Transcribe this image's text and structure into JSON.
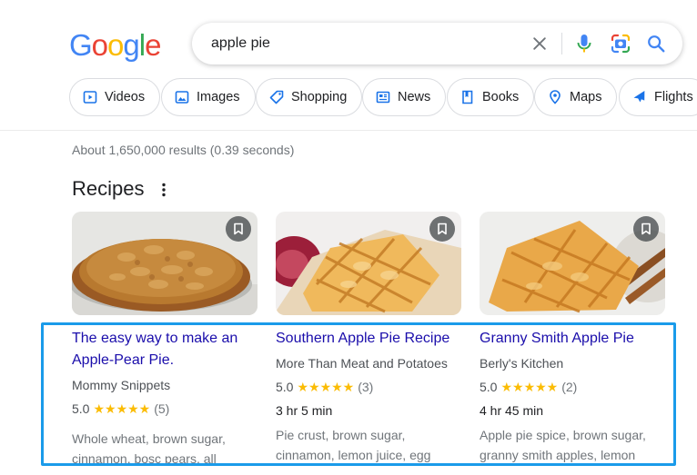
{
  "logo": {
    "text": "Google"
  },
  "search": {
    "query": "apple pie"
  },
  "chips": [
    {
      "label": "Videos",
      "icon": "video-icon"
    },
    {
      "label": "Images",
      "icon": "image-icon"
    },
    {
      "label": "Shopping",
      "icon": "tag-icon"
    },
    {
      "label": "News",
      "icon": "news-icon"
    },
    {
      "label": "Books",
      "icon": "book-icon"
    },
    {
      "label": "Maps",
      "icon": "map-pin-icon"
    },
    {
      "label": "Flights",
      "icon": "plane-icon"
    }
  ],
  "results": {
    "stats": "About 1,650,000 results (0.39 seconds)"
  },
  "recipes": {
    "title": "Recipes",
    "cards": [
      {
        "title": "The easy way to make an Apple-Pear Pie.",
        "source": "Mommy Snippets",
        "rating": "5.0",
        "stars": "★★★★★",
        "reviews": "(5)",
        "time": "",
        "ingredients": "Whole wheat, brown sugar, cinnamon, bosc pears, all"
      },
      {
        "title": "Southern Apple Pie Recipe",
        "source": "More Than Meat and Potatoes",
        "rating": "5.0",
        "stars": "★★★★★",
        "reviews": "(3)",
        "time": "3 hr 5 min",
        "ingredients": "Pie crust, brown sugar, cinnamon, lemon juice, egg"
      },
      {
        "title": "Granny Smith Apple Pie",
        "source": "Berly's Kitchen",
        "rating": "5.0",
        "stars": "★★★★★",
        "reviews": "(2)",
        "time": "4 hr 45 min",
        "ingredients": "Apple pie spice, brown sugar, granny smith apples, lemon"
      }
    ]
  },
  "colors": {
    "link": "#1a0dab",
    "star": "#fbbc04",
    "highlight": "#1a9bea",
    "google_blue": "#4285f4",
    "google_red": "#ea4335",
    "google_yellow": "#fbbc05",
    "google_green": "#34a853"
  }
}
